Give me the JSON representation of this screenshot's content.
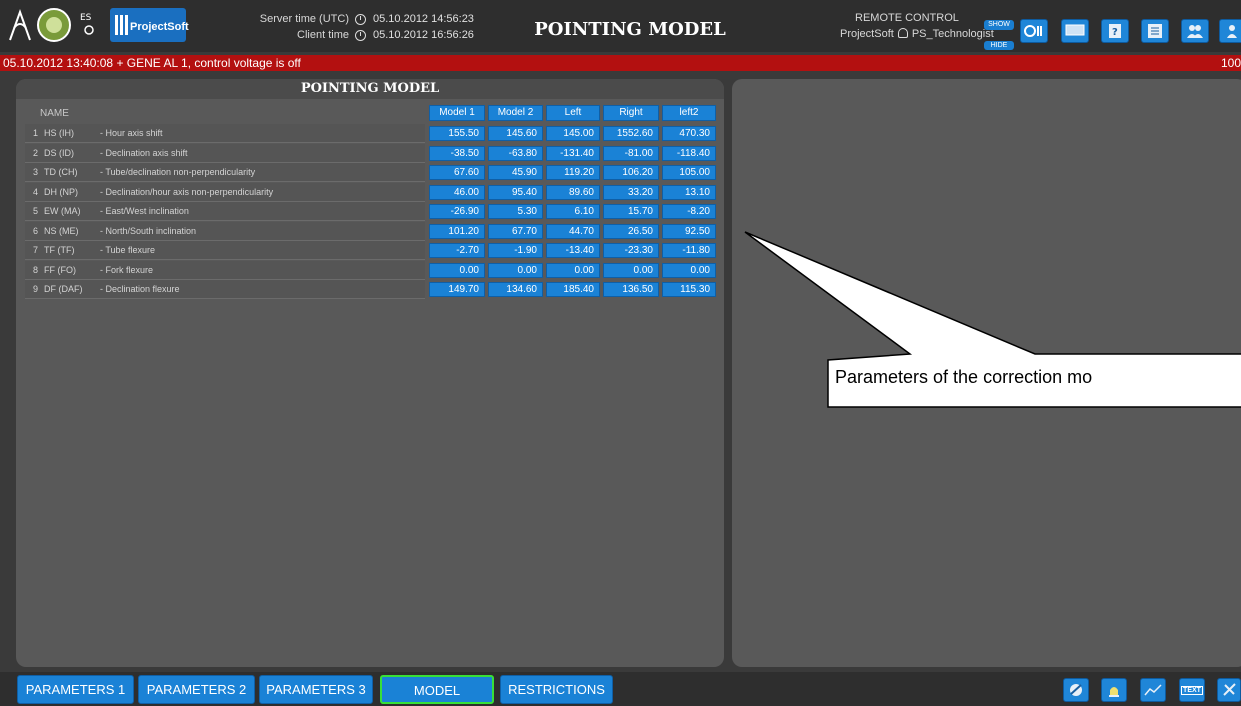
{
  "header": {
    "logo_text": "ProjectSoft",
    "server_time_label": "Server time (UTC)",
    "server_time_value": "05.10.2012 14:56:23",
    "client_time_label": "Client time",
    "client_time_value": "05.10.2012 16:56:26",
    "title": "POINTING MODEL",
    "remote_control_label": "REMOTE CONTROL",
    "remote_user": "ProjectSoft",
    "remote_role": "PS_Technologist",
    "show_label": "SHOW",
    "hide_label": "HIDE",
    "toolbar_icons": [
      "telescope-icon",
      "monitor-icon",
      "help-icon",
      "notes-icon",
      "users-icon",
      "group-icon"
    ]
  },
  "alarm": {
    "text": "05.10.2012 13:40:08  +  GENE AL 1, control voltage is off",
    "count": "100"
  },
  "panel": {
    "title": "POINTING MODEL",
    "name_header": "NAME",
    "columns": [
      "Model 1",
      "Model 2",
      "Left",
      "Right",
      "left2"
    ],
    "rows": [
      {
        "num": "1",
        "code": "HS (IH)",
        "desc": "- Hour axis shift",
        "values": [
          "155.50",
          "145.60",
          "145.00",
          "1552.60",
          "470.30"
        ]
      },
      {
        "num": "2",
        "code": "DS (ID)",
        "desc": "- Declination axis shift",
        "values": [
          "-38.50",
          "-63.80",
          "-131.40",
          "-81.00",
          "-118.40"
        ]
      },
      {
        "num": "3",
        "code": "TD (CH)",
        "desc": "- Tube/declination non-perpendicularity",
        "values": [
          "67.60",
          "45.90",
          "119.20",
          "106.20",
          "105.00"
        ]
      },
      {
        "num": "4",
        "code": "DH (NP)",
        "desc": "- Declination/hour axis non-perpendicularity",
        "values": [
          "46.00",
          "95.40",
          "89.60",
          "33.20",
          "13.10"
        ]
      },
      {
        "num": "5",
        "code": "EW (MA)",
        "desc": "- East/West inclination",
        "values": [
          "-26.90",
          "5.30",
          "6.10",
          "15.70",
          "-8.20"
        ]
      },
      {
        "num": "6",
        "code": "NS (ME)",
        "desc": "- North/South inclination",
        "values": [
          "101.20",
          "67.70",
          "44.70",
          "26.50",
          "92.50"
        ]
      },
      {
        "num": "7",
        "code": "TF (TF)",
        "desc": "- Tube flexure",
        "values": [
          "-2.70",
          "-1.90",
          "-13.40",
          "-23.30",
          "-11.80"
        ]
      },
      {
        "num": "8",
        "code": "FF (FO)",
        "desc": "- Fork flexure",
        "values": [
          "0.00",
          "0.00",
          "0.00",
          "0.00",
          "0.00"
        ]
      },
      {
        "num": "9",
        "code": "DF (DAF)",
        "desc": "- Declination flexure",
        "values": [
          "149.70",
          "134.60",
          "185.40",
          "136.50",
          "115.30"
        ]
      }
    ]
  },
  "callout": {
    "text": "Parameters of the correction mo"
  },
  "tabs": {
    "items": [
      "PARAMETERS 1",
      "PARAMETERS 2",
      "PARAMETERS 3",
      "MODEL",
      "RESTRICTIONS"
    ],
    "active": "MODEL"
  },
  "bottom_icons": [
    "dome-icon",
    "alarm-icon",
    "trend-icon",
    "text-icon",
    "tools-icon"
  ],
  "bottom_icon_text": "TEXT",
  "colors": {
    "accent": "#1a82d6",
    "alarm": "#b31010",
    "active_tab_border": "#38e038"
  }
}
